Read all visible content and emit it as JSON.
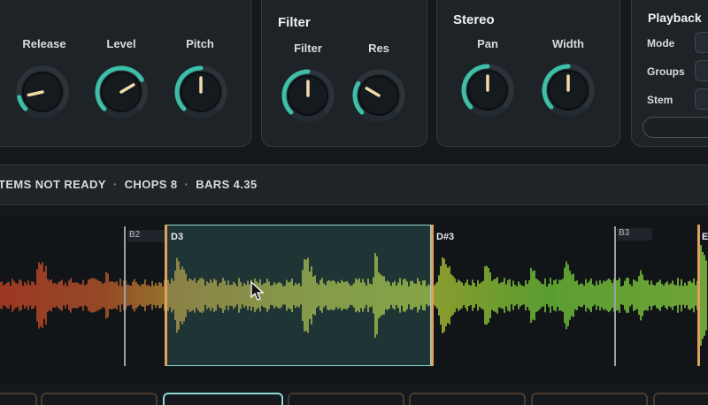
{
  "knobs_left": {
    "items": [
      {
        "label": "Release",
        "value": 0.12
      },
      {
        "label": "Level",
        "value": 0.72
      },
      {
        "label": "Pitch",
        "value": 0.5
      }
    ]
  },
  "filter": {
    "title": "Filter",
    "items": [
      {
        "label": "Filter",
        "value": 0.5
      },
      {
        "label": "Res",
        "value": 0.28
      }
    ]
  },
  "stereo": {
    "title": "Stereo",
    "items": [
      {
        "label": "Pan",
        "value": 0.5
      },
      {
        "label": "Width",
        "value": 0.5
      }
    ]
  },
  "playback": {
    "title": "Playback",
    "rows": [
      {
        "label": "Mode"
      },
      {
        "label": "Groups"
      },
      {
        "label": "Stem"
      }
    ]
  },
  "status": {
    "stems": "TEMS NOT READY",
    "chops": "CHOPS 8",
    "bars": "BARS 4.35",
    "separator": "·"
  },
  "waveform": {
    "markers": [
      {
        "label": "B2"
      },
      {
        "label": "D3"
      },
      {
        "label": "D#3"
      },
      {
        "label": "B3"
      },
      {
        "label": "E"
      }
    ],
    "selected_marker": "D3"
  },
  "colors": {
    "accent": "#3dbfa8",
    "selection": "#7fd6cf",
    "knob_pointer": "#f3d9a8",
    "chop_border": "#e0a060"
  }
}
